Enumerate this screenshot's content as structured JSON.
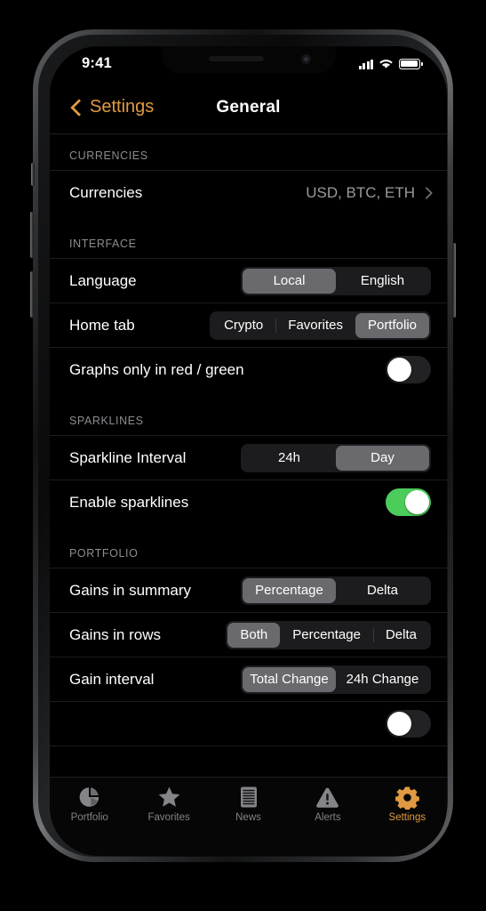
{
  "device": {
    "frame_name": "iphone-frame"
  },
  "status_bar": {
    "time": "9:41",
    "signal_icon": "cellular-signal-icon",
    "wifi_icon": "wifi-icon",
    "battery_icon": "battery-icon"
  },
  "nav": {
    "back_label": "Settings",
    "back_icon": "chevron-left-icon",
    "title": "General"
  },
  "accent_color": "#e09a42",
  "toggle_on_color": "#4ccc5b",
  "sections": [
    {
      "header": "CURRENCIES",
      "rows": [
        {
          "type": "disclosure",
          "label": "Currencies",
          "value": "USD, BTC, ETH",
          "icon": "chevron-right-icon"
        }
      ]
    },
    {
      "header": "INTERFACE",
      "rows": [
        {
          "type": "segmented-wide",
          "label": "Language",
          "options": [
            "Local",
            "English"
          ],
          "selected": "Local"
        },
        {
          "type": "segmented",
          "label": "Home tab",
          "options": [
            "Crypto",
            "Favorites",
            "Portfolio"
          ],
          "selected": "Portfolio"
        },
        {
          "type": "toggle",
          "label": "Graphs only in red / green",
          "state": "off"
        }
      ]
    },
    {
      "header": "SPARKLINES",
      "rows": [
        {
          "type": "segmented-wide",
          "label": "Sparkline Interval",
          "options": [
            "24h",
            "Day"
          ],
          "selected": "Day"
        },
        {
          "type": "toggle",
          "label": "Enable sparklines",
          "state": "on"
        }
      ]
    },
    {
      "header": "PORTFOLIO",
      "rows": [
        {
          "type": "segmented-wide",
          "label": "Gains in summary",
          "options": [
            "Percentage",
            "Delta"
          ],
          "selected": "Percentage"
        },
        {
          "type": "segmented",
          "label": "Gains in rows",
          "options": [
            "Both",
            "Percentage",
            "Delta"
          ],
          "selected": "Both"
        },
        {
          "type": "segmented-wide",
          "label": "Gain interval",
          "options": [
            "Total Change",
            "24h Change"
          ],
          "selected": "Total Change"
        },
        {
          "type": "toggle",
          "label": "",
          "state": "off"
        }
      ]
    }
  ],
  "tab_bar": {
    "tabs": [
      {
        "label": "Portfolio",
        "icon": "pie-chart-icon",
        "active": false
      },
      {
        "label": "Favorites",
        "icon": "star-icon",
        "active": false
      },
      {
        "label": "News",
        "icon": "document-icon",
        "active": false
      },
      {
        "label": "Alerts",
        "icon": "warning-triangle-icon",
        "active": false
      },
      {
        "label": "Settings",
        "icon": "gear-icon",
        "active": true
      }
    ]
  }
}
